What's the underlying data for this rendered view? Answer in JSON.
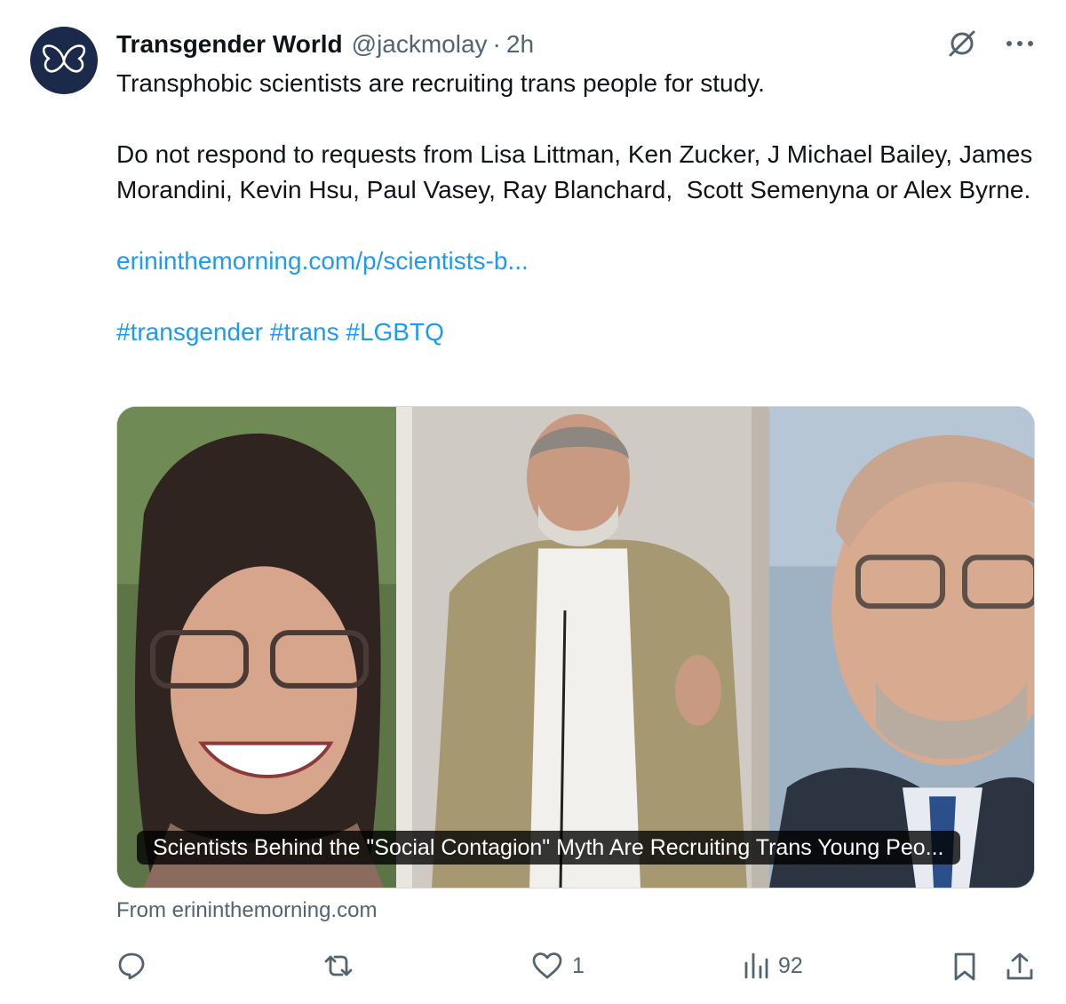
{
  "post": {
    "display_name": "Transgender World",
    "handle": "@jackmolay",
    "separator": "·",
    "time": "2h",
    "text_line1": "Transphobic scientists are recruiting trans people for study.",
    "text_para2": "Do not respond to requests from Lisa Littman, Ken Zucker, J Michael Bailey, James Morandini, Kevin Hsu, Paul Vasey, Ray Blanchard,  Scott Semenyna or Alex Byrne.",
    "link": "erininthemorning.com/p/scientists-b...",
    "hashtags": "#transgender #trans #LGBTQ"
  },
  "card": {
    "title": "Scientists Behind the \"Social Contagion\" Myth Are Recruiting Trans Young Peo...",
    "source": "From erininthemorning.com"
  },
  "actions": {
    "replies": "",
    "reposts": "",
    "likes": "1",
    "views": "92"
  },
  "icons": {
    "avatar": "butterfly-icon",
    "top": [
      "grok-icon",
      "more-icon"
    ],
    "actions": [
      "reply-icon",
      "repost-icon",
      "like-icon",
      "views-icon",
      "bookmark-icon",
      "share-icon"
    ]
  },
  "colors": {
    "link": "#1d9bf0",
    "secondary_text": "#536471",
    "avatar_bg": "#1b2a4a"
  }
}
